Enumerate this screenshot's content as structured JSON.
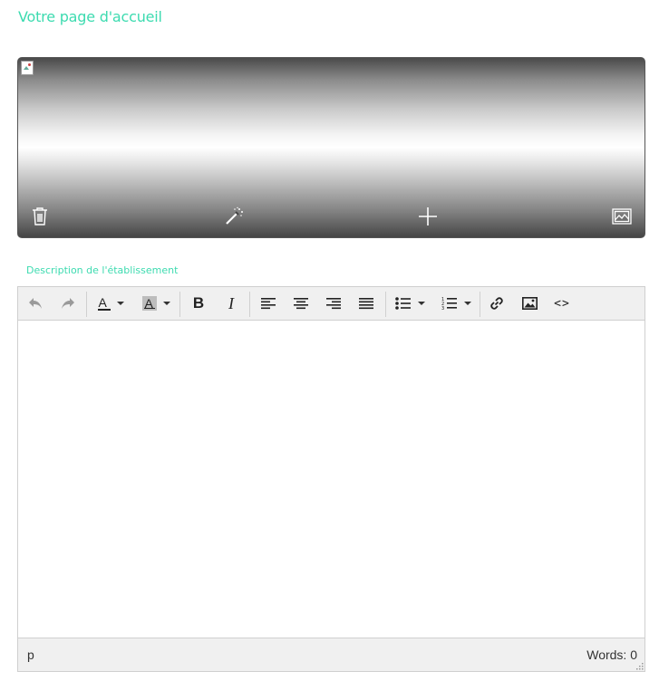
{
  "page": {
    "title": "Votre page d'accueil",
    "accent_color": "#3ddbb0"
  },
  "banner": {
    "image": "broken-image-icon",
    "actions": [
      "trash-icon",
      "magic-wand-icon",
      "plus-icon",
      "image-icon"
    ]
  },
  "description": {
    "label": "Description de l'établissement"
  },
  "editor": {
    "toolbar": {
      "undo": "undo-icon",
      "redo": "redo-icon",
      "text_color": "A",
      "background_color": "A",
      "bold": "B",
      "italic": "I",
      "align": [
        "align-left-icon",
        "align-center-icon",
        "align-right-icon",
        "align-justify-icon"
      ],
      "bullet_list": "bullet-list-icon",
      "numbered_list": "numbered-list-icon",
      "link": "link-icon",
      "image": "image-icon",
      "code": "<>"
    },
    "content": "",
    "status": {
      "path": "p",
      "word_count": "Words: 0"
    }
  }
}
